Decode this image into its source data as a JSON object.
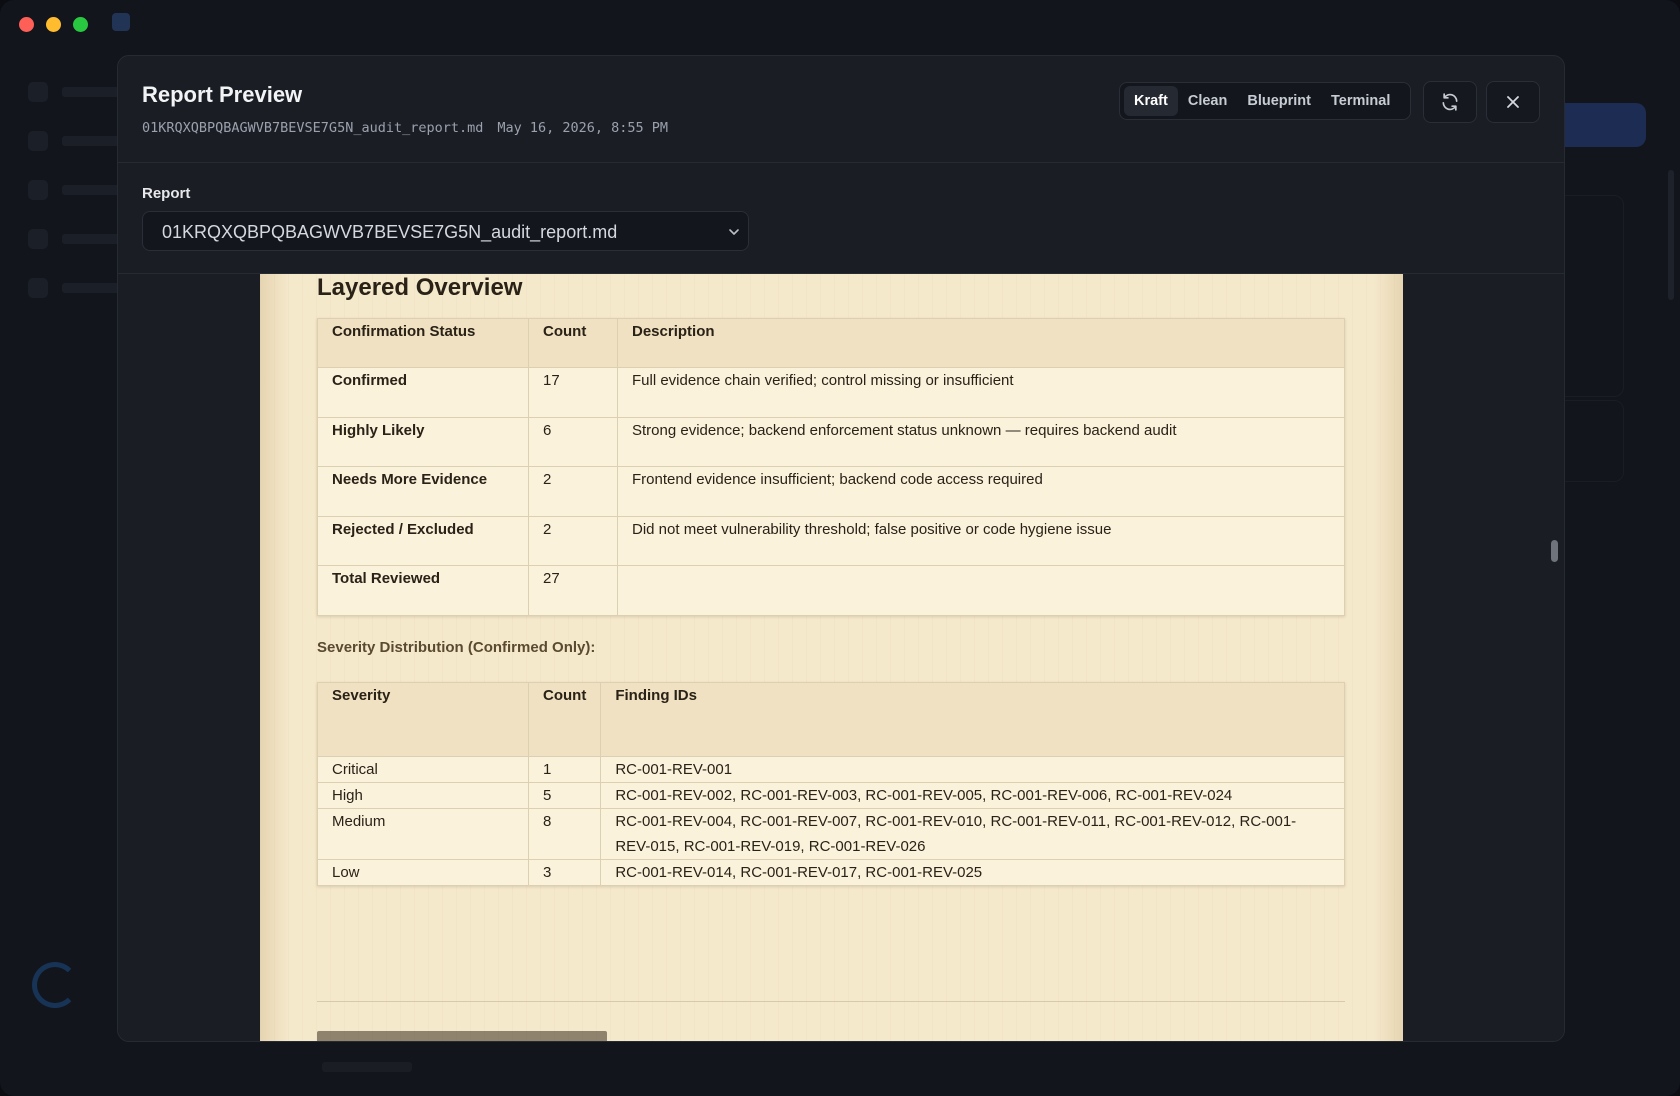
{
  "window": {
    "app_name": ""
  },
  "modal": {
    "title": "Report Preview",
    "file_name": "01KRQXQBPQBAGWVB7BEVSE7G5N_audit_report.md",
    "timestamp": "May 16, 2026, 8:55 PM",
    "themes": [
      {
        "label": "Kraft",
        "active": true
      },
      {
        "label": "Clean",
        "active": false
      },
      {
        "label": "Blueprint",
        "active": false
      },
      {
        "label": "Terminal",
        "active": false
      }
    ],
    "refresh_icon": "refresh-icon",
    "close_icon": "close-icon"
  },
  "report_picker": {
    "label": "Report",
    "selected": "01KRQXQBPQBAGWVB7BEVSE7G5N_audit_report.md",
    "chevron_icon": "chevron-down-icon"
  },
  "document": {
    "heading": "Layered Overview",
    "confirmation_table": {
      "headers": [
        "Confirmation Status",
        "Count",
        "Description"
      ],
      "rows": [
        [
          "Confirmed",
          "17",
          "Full evidence chain verified; control missing or insufficient"
        ],
        [
          "Highly Likely",
          "6",
          "Strong evidence; backend enforcement status unknown — requires backend audit"
        ],
        [
          "Needs More Evidence",
          "2",
          "Frontend evidence insufficient; backend code access required"
        ],
        [
          "Rejected / Excluded",
          "2",
          "Did not meet vulnerability threshold; false positive or code hygiene issue"
        ],
        [
          "Total Reviewed",
          "27",
          ""
        ]
      ]
    },
    "severity_caption": "Severity Distribution (Confirmed Only):",
    "severity_table": {
      "headers": [
        "Severity",
        "Count",
        "Finding IDs"
      ],
      "rows": [
        [
          "Critical",
          "1",
          "RC-001-REV-001"
        ],
        [
          "High",
          "5",
          "RC-001-REV-002, RC-001-REV-003, RC-001-REV-005, RC-001-REV-006, RC-001-REV-024"
        ],
        [
          "Medium",
          "8",
          "RC-001-REV-004, RC-001-REV-007, RC-001-REV-010, RC-001-REV-011, RC-001-REV-012, RC-001-REV-015, RC-001-REV-019, RC-001-REV-026"
        ],
        [
          "Low",
          "3",
          "RC-001-REV-014, RC-001-REV-017, RC-001-REV-025"
        ]
      ]
    }
  }
}
